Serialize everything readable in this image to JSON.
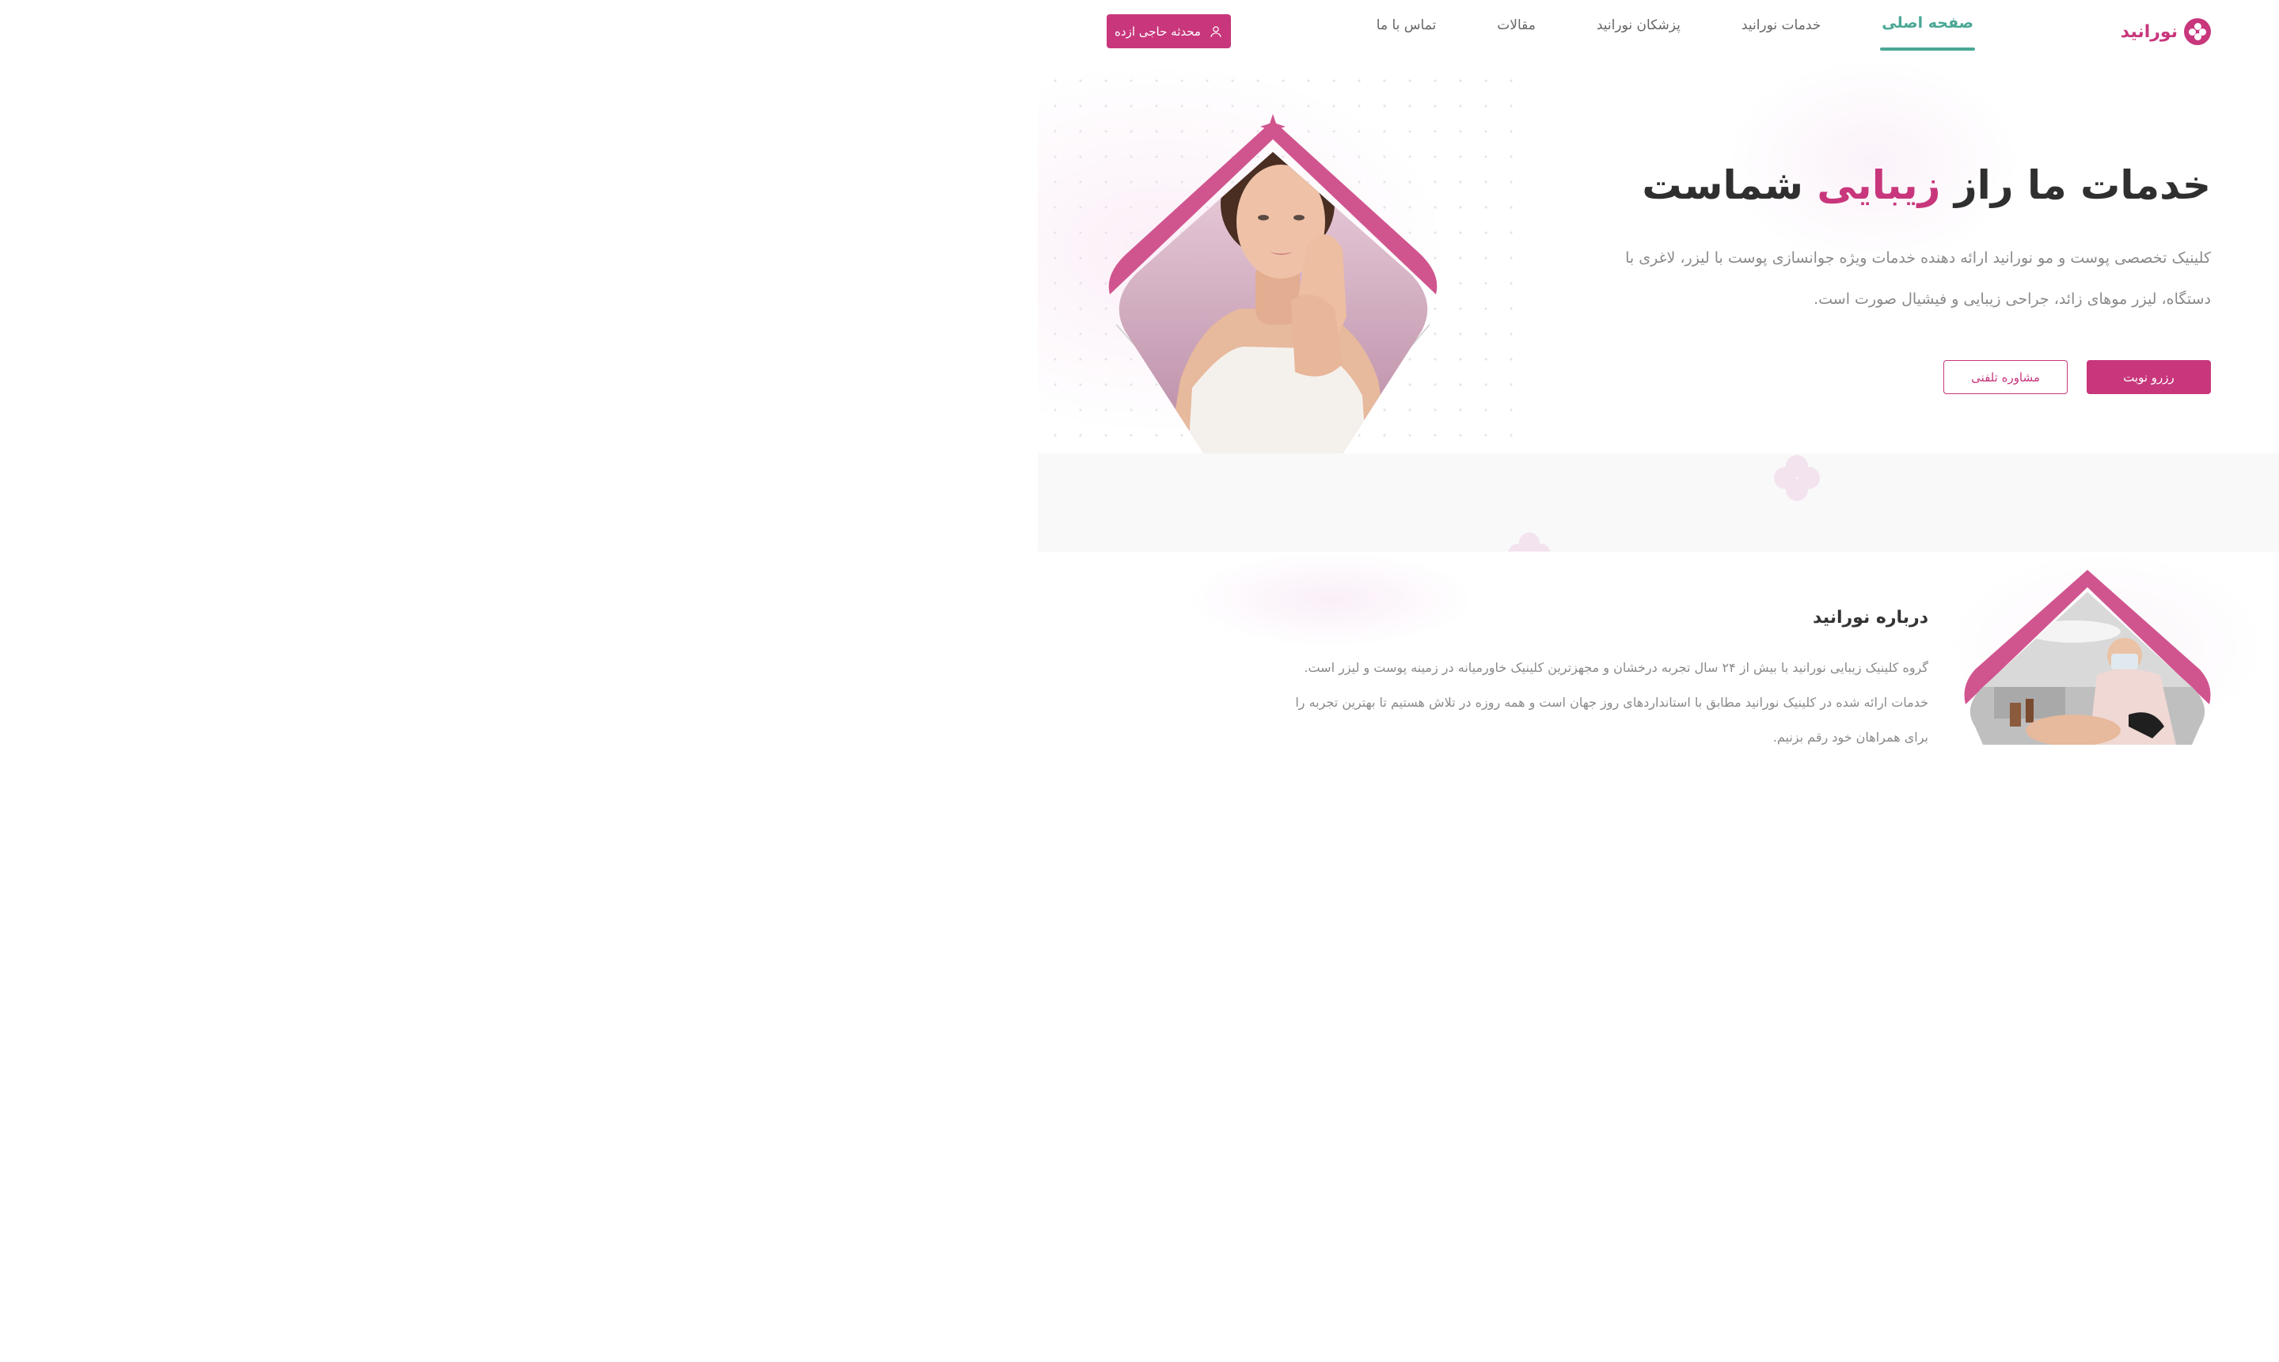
{
  "brand": {
    "name": "نورانید",
    "color": "#c8377c",
    "accent_green": "#4aa795"
  },
  "nav": {
    "items": [
      {
        "label": "صفحه اصلی",
        "active": true
      },
      {
        "label": "خدمات نورانید",
        "active": false
      },
      {
        "label": "پزشکان نورانید",
        "active": false
      },
      {
        "label": "مقالات",
        "active": false
      },
      {
        "label": "تماس با ما",
        "active": false
      }
    ]
  },
  "user": {
    "name": "محدثه حاجی ازده",
    "icon": "user-icon"
  },
  "hero": {
    "title_before": "خدمات ما راز ",
    "title_accent": "زیبایی",
    "title_after": " شماست",
    "description": "کلینیک تخصصی پوست و مو نورانید ارائه دهنده خدمات ویژه جوانسازی پوست با لیزر، لاغری با دستگاه، لیزر موهای زائد، جراحی زیبایی و فیشیال صورت است.",
    "primary_button": "رزرو نوبت",
    "secondary_button": "مشاوره تلفنی"
  },
  "about": {
    "title": "درباره نورانید",
    "text": "گروه کلینیک زیبایی نورانید با بیش از ۲۴ سال تجربه درخشان و مجهزترین کلینیک خاورمیانه در زمینه پوست و لیزر است. خدمات ارائه شده در کلینیک نورانید مطابق با استانداردهای روز جهان است و همه روزه در تلاش هستیم تا بهترین تجربه را برای همراهان خود رقم بزنیم."
  }
}
